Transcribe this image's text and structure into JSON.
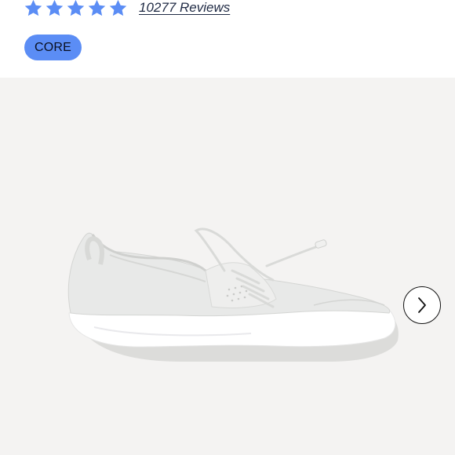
{
  "rating": {
    "stars_filled": 5,
    "stars_total": 5,
    "star_color": "#5b8df5",
    "reviews_text": "10277 Reviews"
  },
  "badge": {
    "label": "CORE",
    "color": "#5b8df5"
  },
  "gallery": {
    "image_alt": "white sneaker",
    "background": "#f4f3f2",
    "next_icon": "chevron-right-icon"
  }
}
